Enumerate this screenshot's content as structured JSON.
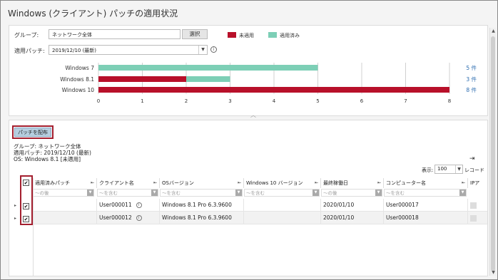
{
  "page_title": "Windows (クライアント) パッチの適用状況",
  "filters": {
    "group_label": "グループ:",
    "group_value": "ネットワーク全体",
    "select_button": "選択",
    "patch_label": "適用パッチ:",
    "patch_value": "2019/12/10 (最新)"
  },
  "legend": [
    {
      "label": "未適用",
      "color": "#b8102a"
    },
    {
      "label": "適用済み",
      "color": "#7dcfb6"
    }
  ],
  "chart_data": {
    "type": "bar",
    "orientation": "horizontal",
    "stacked": true,
    "categories": [
      "Windows 7",
      "Windows 8.1",
      "Windows 10"
    ],
    "series": [
      {
        "name": "未適用",
        "color": "#b8102a",
        "values": [
          0,
          2,
          8
        ]
      },
      {
        "name": "適用済み",
        "color": "#7dcfb6",
        "values": [
          5,
          1,
          0
        ]
      }
    ],
    "totals": [
      "5 件",
      "3 件",
      "8 件"
    ],
    "xlim": [
      0,
      8
    ],
    "xticks": [
      "0",
      "1",
      "2",
      "3",
      "4",
      "5",
      "6",
      "7",
      "8"
    ],
    "grid": true
  },
  "deploy_button": "パッチを配布",
  "selection_info": {
    "group": "グループ: ネットワーク全体",
    "patch": "適用パッチ: 2019/12/10 (最新)",
    "os": "OS: Windows 8.1 [未適用]"
  },
  "display": {
    "label": "表示:",
    "value": "100",
    "suffix": "レコード"
  },
  "table": {
    "columns": [
      {
        "label": "適用済みパッチ",
        "filter": "〜の後"
      },
      {
        "label": "クライアント名",
        "filter": "〜を含む"
      },
      {
        "label": "OSバージョン",
        "filter": "〜を含む"
      },
      {
        "label": "Windows 10 バージョン",
        "filter": "〜を含む"
      },
      {
        "label": "最終稼働日",
        "filter": "〜の後"
      },
      {
        "label": "コンピューター名",
        "filter": "〜を含む"
      },
      {
        "label": "IPア",
        "filter": ""
      }
    ],
    "rows": [
      {
        "patch": "",
        "client": "User000011",
        "os": "Windows 8.1 Pro 6.3.9600",
        "win10": "",
        "last": "2020/01/10",
        "computer": "User000017"
      },
      {
        "patch": "",
        "client": "User000012",
        "os": "Windows 8.1 Pro 6.3.9600",
        "win10": "",
        "last": "2020/01/10",
        "computer": "User000018"
      }
    ]
  }
}
